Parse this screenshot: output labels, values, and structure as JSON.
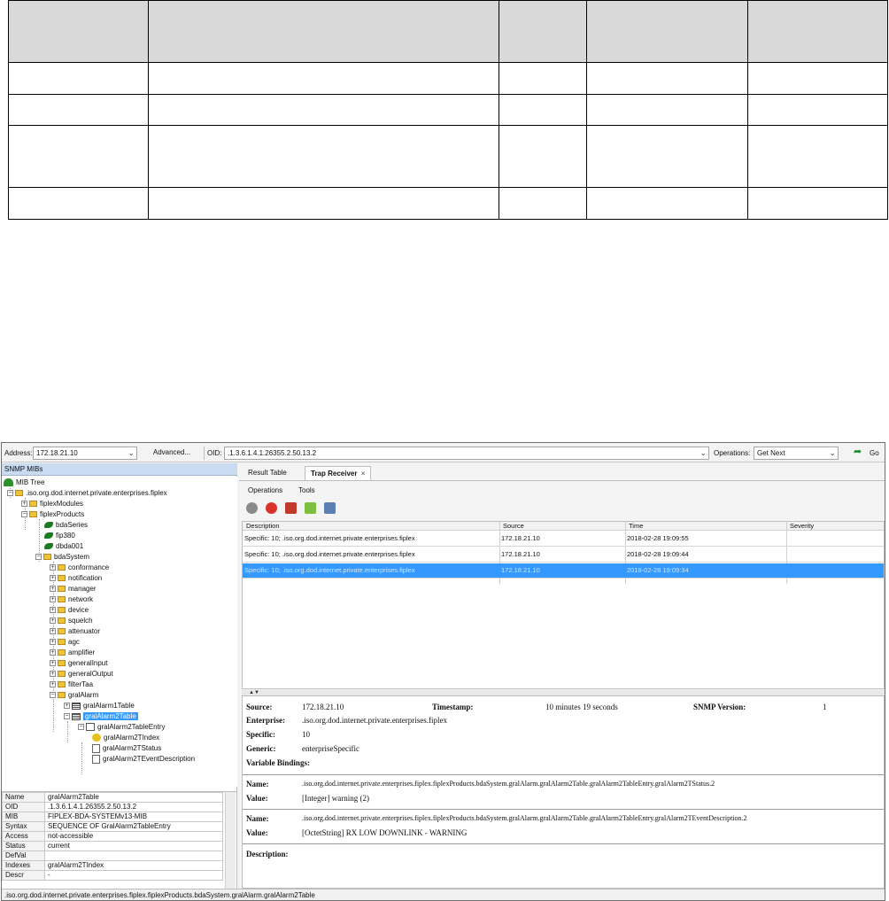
{
  "toolbar": {
    "address_label": "Address:",
    "address_value": "172.18.21.10",
    "advanced_label": "Advanced...",
    "oid_label": "OID:",
    "oid_value": ".1.3.6.1.4.1.26355.2.50.13.2",
    "operations_label": "Operations:",
    "operations_value": "Get Next",
    "go_label": "Go"
  },
  "left": {
    "header": "SNMP MIBs",
    "tree": {
      "root": "MIB Tree",
      "n1": ".iso.org.dod.internet.private.enterprises.fiplex",
      "n2": "fiplexModules",
      "n3": "fiplexProducts",
      "n4": "bdaSeries",
      "n5": "fip380",
      "n6": "dbda001",
      "n7": "bdaSystem",
      "n8": "conformance",
      "n9": "notification",
      "n10": "manager",
      "n11": "network",
      "n12": "device",
      "n13": "squelch",
      "n14": "attenuator",
      "n15": "agc",
      "n16": "amplifier",
      "n17": "generalInput",
      "n18": "generalOutput",
      "n19": "filterTaa",
      "n20": "gralAlarm",
      "n21": "gralAlarm1Table",
      "n22": "gralAlarm2Table",
      "n23": "gralAlarm2TableEntry",
      "n24": "gralAlarm2TIndex",
      "n25": "gralAlarm2TStatus",
      "n26": "gralAlarm2TEventDescription"
    },
    "props": [
      {
        "k": "Name",
        "v": "gralAlarm2Table"
      },
      {
        "k": "OID",
        "v": ".1.3.6.1.4.1.26355.2.50.13.2"
      },
      {
        "k": "MIB",
        "v": "FIPLEX-BDA-SYSTEMv13-MIB"
      },
      {
        "k": "Syntax",
        "v": "SEQUENCE OF GralAlarm2TableEntry"
      },
      {
        "k": "Access",
        "v": "not-accessible"
      },
      {
        "k": "Status",
        "v": "current"
      },
      {
        "k": "DefVal",
        "v": ""
      },
      {
        "k": "Indexes",
        "v": "gralAlarm2TIndex"
      },
      {
        "k": "Descr",
        "v": "-"
      }
    ]
  },
  "status_bar": ".iso.org.dod.internet.private.enterprises.fiplex.fiplexProducts.bdaSystem.gralAlarm.gralAlarm2Table",
  "right": {
    "tab1": "Result Table",
    "tab2": "Trap Receiver",
    "tab2_close": "×",
    "menu_operations": "Operations",
    "menu_tools": "Tools",
    "columns": {
      "description": "Description",
      "source": "Source",
      "time": "Time",
      "severity": "Severity"
    },
    "rows": [
      {
        "description": "Specific: 10; .iso.org.dod.internet.private.enterprises.fiplex",
        "source": "172.18.21.10",
        "time": "2018-02-28 19:09:55"
      },
      {
        "description": "Specific: 10; .iso.org.dod.internet.private.enterprises.fiplex",
        "source": "172.18.21.10",
        "time": "2018-02-28 19:09:44"
      },
      {
        "description": "Specific: 10; .iso.org.dod.internet.private.enterprises.fiplex",
        "source": "172.18.21.10",
        "time": "2018-02-28 19:09:34"
      }
    ],
    "detail": {
      "source_label": "Source:",
      "source_value": "172.18.21.10",
      "timestamp_label": "Timestamp:",
      "timestamp_value": "10 minutes 19 seconds",
      "snmp_label": "SNMP Version:",
      "snmp_value": "1",
      "enterprise_label": "Enterprise:",
      "enterprise_value": ".iso.org.dod.internet.private.enterprises.fiplex",
      "specific_label": "Specific:",
      "specific_value": "10",
      "generic_label": "Generic:",
      "generic_value": "enterpriseSpecific",
      "varbind_label": "Variable Bindings:",
      "name_label": "Name:",
      "value_label": "Value:",
      "b1_name": ".iso.org.dod.internet.private.enterprises.fiplex.fiplexProducts.bdaSystem.gralAlarm.gralAlarm2Table.gralAlarm2TableEntry.gralAlarm2TStatus.2",
      "b1_value": "[Integer] warning (2)",
      "b2_name": ".iso.org.dod.internet.private.enterprises.fiplex.fiplexProducts.bdaSystem.gralAlarm.gralAlarm2Table.gralAlarm2TableEntry.gralAlarm2TEventDescription.2",
      "b2_value": "[OctetString] RX LOW DOWNLINK - WARNING",
      "description_label": "Description:"
    }
  },
  "colors": {
    "selection": "#3399ff",
    "snmp_header": "#c8dbf0",
    "table_header": "#d9d9d9"
  }
}
